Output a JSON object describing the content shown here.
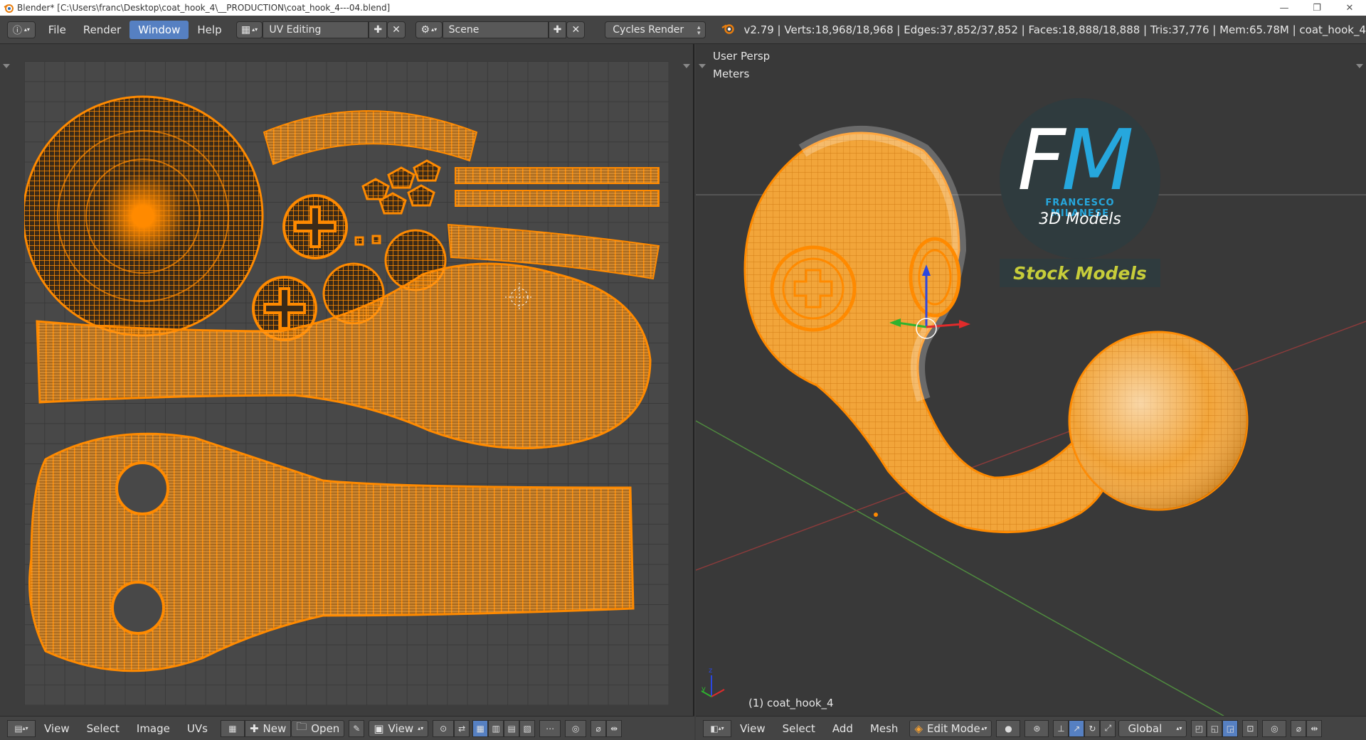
{
  "window": {
    "title": "Blender* [C:\\Users\\franc\\Desktop\\coat_hook_4\\__PRODUCTION\\coat_hook_4---04.blend]",
    "minimize": "—",
    "restore": "❐",
    "close": "✕"
  },
  "info_header": {
    "menus": [
      "File",
      "Render",
      "Window",
      "Help"
    ],
    "active_menu": "Window",
    "layout": "UV Editing",
    "scene": "Scene",
    "render_engine": "Cycles Render",
    "stats": "v2.79 | Verts:18,968/18,968 | Edges:37,852/37,852 | Faces:18,888/18,888 | Tris:37,776 | Mem:65.78M | coat_hook_4"
  },
  "uv_footer": {
    "menus": [
      "View",
      "Select",
      "Image",
      "UVs"
    ],
    "new_label": "New",
    "open_label": "Open",
    "view_label": "View"
  },
  "viewport": {
    "view_name": "User Persp",
    "units": "Meters",
    "object_label": "(1) coat_hook_4"
  },
  "view3d_footer": {
    "menus": [
      "View",
      "Select",
      "Add",
      "Mesh"
    ],
    "mode": "Edit Mode",
    "orientation": "Global"
  },
  "logo": {
    "f": "F",
    "m": "M",
    "name": "FRANCESCO MILANESE",
    "subtitle": "3D Models",
    "banner": "Stock Models"
  },
  "colors": {
    "accent": "#5680c2",
    "uv_orange": "#ff8a00",
    "mesh_orange": "#f5a031",
    "logo_blue": "#26a7dd",
    "logo_yellow": "#c7cd3a"
  }
}
